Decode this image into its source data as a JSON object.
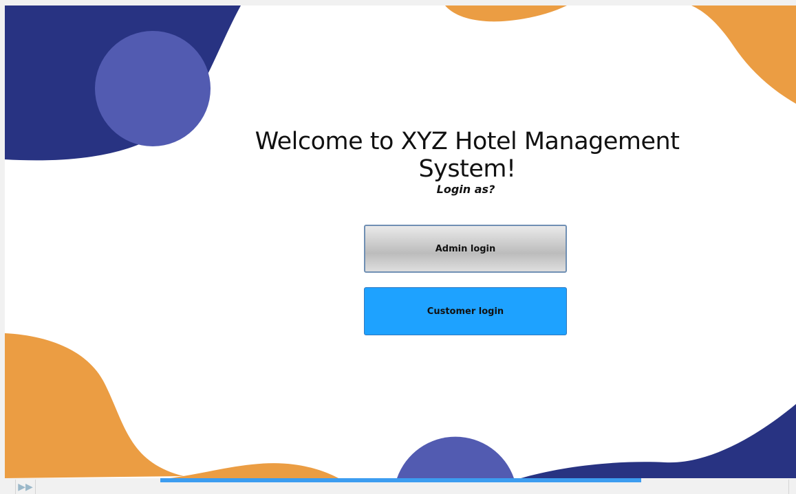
{
  "window": {
    "title": "Welcome to XYZ Hotel Management System!",
    "prompt": "Login as?"
  },
  "buttons": {
    "admin_login": "Admin login",
    "customer_login": "Customer login"
  },
  "statusbar": {
    "play_icon": "fast-forward-icon",
    "progress": 0.6
  },
  "colors": {
    "navy": "#283382",
    "periwinkle": "#525bb1",
    "orange": "#eb9d43",
    "customer_button": "#1ea2ff",
    "progress": "#3c9df0"
  }
}
